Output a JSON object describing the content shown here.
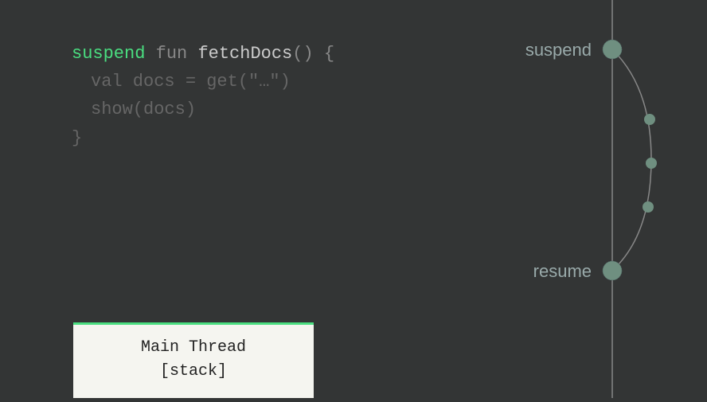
{
  "code": {
    "line1": {
      "suspend": "suspend",
      "fun": "fun",
      "name": "fetchDocs",
      "parens": "()",
      "brace": "{"
    },
    "line2": "val docs = get(\"…\")",
    "line3": "show(docs)",
    "line4": "}"
  },
  "timeline": {
    "suspend_label": "suspend",
    "resume_label": "resume"
  },
  "thread_box": {
    "title": "Main Thread",
    "subtitle": "[stack]"
  },
  "colors": {
    "accent": "#4ade80",
    "bg": "#333535",
    "node": "#7a9a8a"
  }
}
